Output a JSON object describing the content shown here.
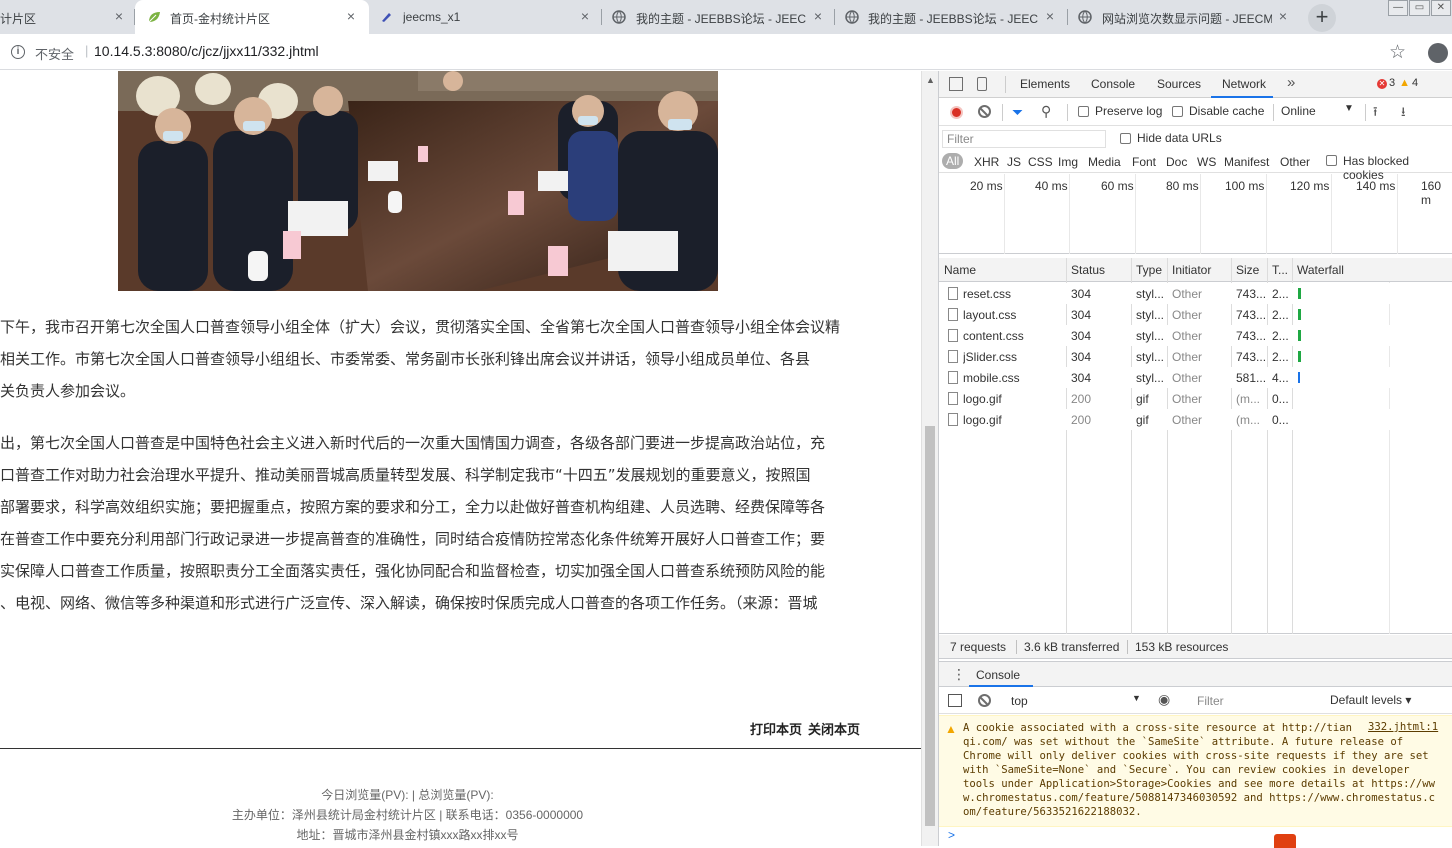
{
  "browser": {
    "tabs": [
      {
        "title": "计片区",
        "active": false,
        "icon": "page-icon"
      },
      {
        "title": "首页-金村统计片区",
        "active": true,
        "icon": "leaf-icon"
      },
      {
        "title": "jeecms_x1",
        "active": false,
        "icon": "pen-icon"
      },
      {
        "title": "我的主题 - JEEBBS论坛 - JEECM",
        "active": false,
        "icon": "globe-icon"
      },
      {
        "title": "我的主题 - JEEBBS论坛 - JEECM",
        "active": false,
        "icon": "globe-icon"
      },
      {
        "title": "网站浏览次数显示问题 - JEECM",
        "active": false,
        "icon": "globe-icon"
      }
    ],
    "new_tab_label": "+",
    "close_glyph": "×",
    "security_label": "不安全",
    "url": "10.14.5.3:8080/c/jcz/jjxx11/332.jhtml"
  },
  "article": {
    "paragraphs": [
      "下午，我市召开第七次全国人口普查领导小组全体（扩大）会议，贯彻落实全国、全省第七次全国人口普查领导小组全体会议精",
      "相关工作。市第七次全国人口普查领导小组组长、市委常委、常务副市长张利锋出席会议并讲话，领导小组成员单位、各县",
      "关负责人参加会议。",
      "出，第七次全国人口普查是中国特色社会主义进入新时代后的一次重大国情国力调查，各级各部门要进一步提高政治站位，充",
      "口普查工作对助力社会治理水平提升、推动美丽晋城高质量转型发展、科学制定我市“十四五”发展规划的重要意义，按照国",
      "部署要求，科学高效组织实施；要把握重点，按照方案的要求和分工，全力以赴做好普查机构组建、人员选聘、经费保障等各",
      "在普查工作中要充分利用部门行政记录进一步提高普查的准确性，同时结合疫情防控常态化条件统筹开展好人口普查工作；要",
      "实保障人口普查工作质量，按照职责分工全面落实责任，强化协同配合和监督检查，切实加强全国人口普查系统预防风险的能",
      "、电视、网络、微信等多种渠道和形式进行广泛宣传、深入解读，确保按时保质完成人口普查的各项工作任务。（来源：晋城"
    ],
    "print_label": "打印本页",
    "close_label": "关闭本页"
  },
  "footer": {
    "views": "今日浏览量(PV):  |  总浏览量(PV):",
    "sponsor": "主办单位：泽州县统计局金村统计片区  |  联系电话：0356-0000000",
    "address": "地址：晋城市泽州县金村镇xxx路xx排xx号"
  },
  "devtools": {
    "tabs": [
      "Elements",
      "Console",
      "Sources",
      "Network"
    ],
    "more": "»",
    "errors": "3",
    "warnings": "4",
    "preserve_log": "Preserve log",
    "disable_cache": "Disable cache",
    "throttle": "Online",
    "filter_placeholder": "Filter",
    "hide_data_urls": "Hide data URLs",
    "types": [
      "All",
      "XHR",
      "JS",
      "CSS",
      "Img",
      "Media",
      "Font",
      "Doc",
      "WS",
      "Manifest",
      "Other"
    ],
    "has_blocked_cookies": "Has blocked cookies",
    "overview_ticks": [
      "20 ms",
      "40 ms",
      "60 ms",
      "80 ms",
      "100 ms",
      "120 ms",
      "140 ms",
      "160 m"
    ],
    "columns": [
      "Name",
      "Status",
      "Type",
      "Initiator",
      "Size",
      "T...",
      "Waterfall"
    ],
    "requests": [
      {
        "name": "reset.css",
        "status": "304",
        "type": "styl...",
        "initiator": "Other",
        "size": "743...",
        "time": "2...",
        "wf": "green"
      },
      {
        "name": "layout.css",
        "status": "304",
        "type": "styl...",
        "initiator": "Other",
        "size": "743...",
        "time": "2...",
        "wf": "green"
      },
      {
        "name": "content.css",
        "status": "304",
        "type": "styl...",
        "initiator": "Other",
        "size": "743...",
        "time": "2...",
        "wf": "green"
      },
      {
        "name": "jSlider.css",
        "status": "304",
        "type": "styl...",
        "initiator": "Other",
        "size": "743...",
        "time": "2...",
        "wf": "green"
      },
      {
        "name": "mobile.css",
        "status": "304",
        "type": "styl...",
        "initiator": "Other",
        "size": "581...",
        "time": "4...",
        "wf": "blue"
      },
      {
        "name": "logo.gif",
        "status": "200",
        "type": "gif",
        "initiator": "Other",
        "size": "(m...",
        "time": "0...",
        "wf": "none"
      },
      {
        "name": "logo.gif",
        "status": "200",
        "type": "gif",
        "initiator": "Other",
        "size": "(m...",
        "time": "0...",
        "wf": "none"
      }
    ],
    "summary": {
      "requests": "7 requests",
      "transferred": "3.6 kB transferred",
      "resources": "153 kB resources"
    },
    "drawer_tab": "Console",
    "context": "top",
    "console_filter": "Filter",
    "levels": "Default levels ▾",
    "warning_text": "A cookie associated with a cross-site resource at http://tian\nqi.com/ was set without the `SameSite` attribute. A future release of\nChrome will only deliver cookies with cross-site requests if they are set\nwith `SameSite=None` and `Secure`. You can review cookies in developer\ntools under Application>Storage>Cookies and see more details at https://ww\nw.chromestatus.com/feature/5088147346030592 and https://www.chromestatus.c\nom/feature/5633521622188032.",
    "warning_source": "332.jhtml:1",
    "prompt": ">"
  },
  "colors": {
    "accent": "#1a73e8",
    "record": "#d93025",
    "waterfall_green": "#1fa843",
    "warning_bg": "#fffbe5"
  }
}
